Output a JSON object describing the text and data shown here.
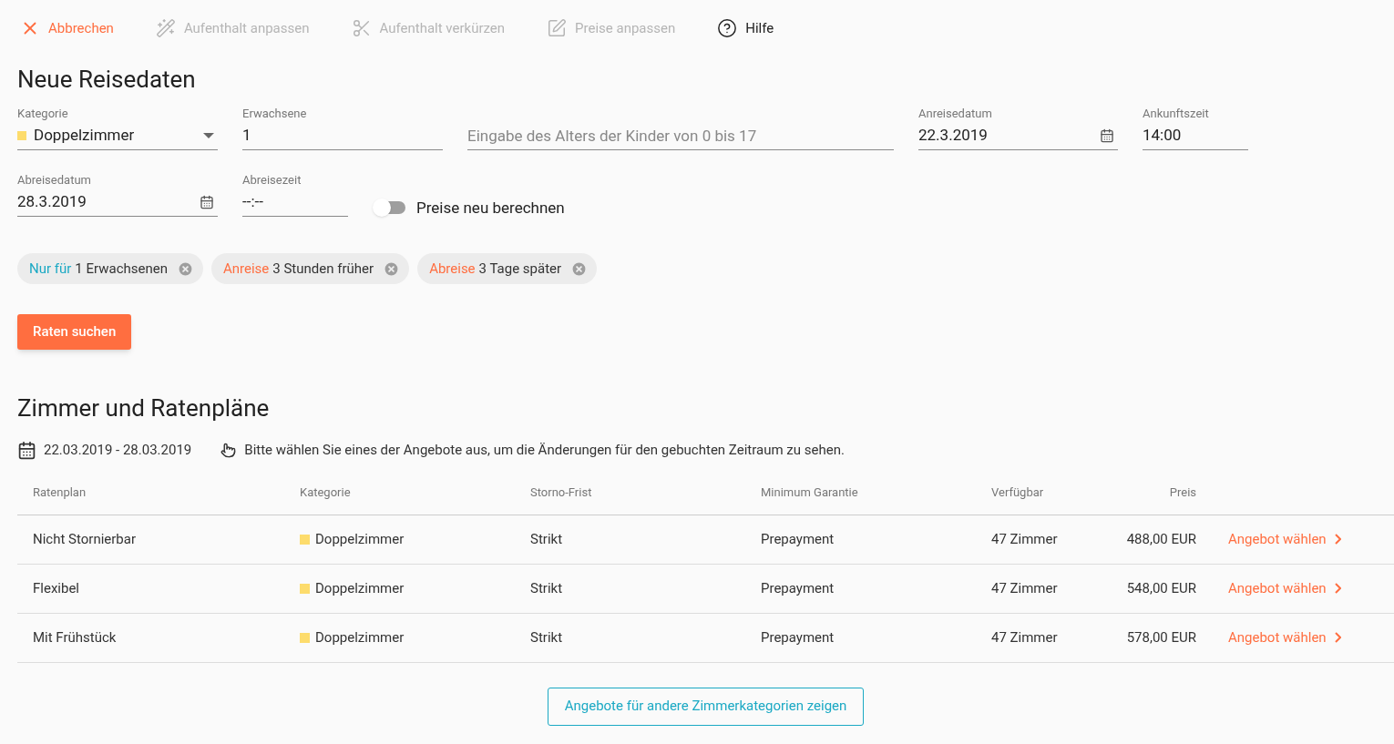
{
  "toolbar": [
    {
      "kind": "cancel",
      "label": "Abbrechen",
      "disabled": false
    },
    {
      "kind": "wand",
      "label": "Aufenthalt anpassen",
      "disabled": true
    },
    {
      "kind": "scissors",
      "label": "Aufenthalt verkürzen",
      "disabled": true
    },
    {
      "kind": "edit",
      "label": "Preise anpassen",
      "disabled": true
    },
    {
      "kind": "help",
      "label": "Hilfe",
      "disabled": false
    }
  ],
  "form": {
    "title": "Neue Reisedaten",
    "row_1": [
      {
        "kind": "select",
        "label": "Kategorie",
        "value": "Doppelzimmer",
        "color": "#fddc6c"
      },
      {
        "kind": "text",
        "label": "Erwachsene",
        "value": "1"
      },
      {
        "kind": "placeholder",
        "placeholder": "Eingabe des Alters der Kinder von 0 bis 17"
      },
      {
        "kind": "date",
        "label": "Anreisedatum",
        "value": "22.3.2019"
      },
      {
        "kind": "text",
        "label": "Ankunftszeit",
        "value": "14:00"
      }
    ],
    "row_2": [
      {
        "kind": "date",
        "label": "Abreisedatum",
        "value": "28.3.2019"
      },
      {
        "kind": "text",
        "label": "Abreisezeit",
        "value": "--:--"
      }
    ],
    "toggle": {
      "label": "Preise neu berechnen",
      "on": false
    },
    "chips": [
      {
        "prefix": "Nur für",
        "text": "1 Erwachsenen",
        "color": "#1ba9c4"
      },
      {
        "prefix": "Anreise",
        "text": "3 Stunden früher",
        "color": "#ff6e40"
      },
      {
        "prefix": "Abreise",
        "text": "3 Tage später",
        "color": "#ff6e40"
      }
    ],
    "search_button": "Raten suchen"
  },
  "rates": {
    "title": "Zimmer und Ratenpläne",
    "date_range": "22.03.2019 - 28.03.2019",
    "hint": "Bitte wählen Sie eines der Angebote aus, um die Änderungen für den gebuchten Zeitraum zu sehen.",
    "columns": [
      "Ratenplan",
      "Kategorie",
      "Storno-Frist",
      "Minimum Garantie",
      "Verfügbar",
      "Preis"
    ],
    "rows": [
      {
        "plan": "Nicht Stornierbar",
        "category": "Doppelzimmer",
        "color": "#fddc6c",
        "cancellation": "Strikt",
        "guarantee": "Prepayment",
        "available": "47 Zimmer",
        "price": "488,00 EUR",
        "action": "Angebot wählen"
      },
      {
        "plan": "Flexibel",
        "category": "Doppelzimmer",
        "color": "#fddc6c",
        "cancellation": "Strikt",
        "guarantee": "Prepayment",
        "available": "47 Zimmer",
        "price": "548,00 EUR",
        "action": "Angebot wählen"
      },
      {
        "plan": "Mit Frühstück",
        "category": "Doppelzimmer",
        "color": "#fddc6c",
        "cancellation": "Strikt",
        "guarantee": "Prepayment",
        "available": "47 Zimmer",
        "price": "578,00 EUR",
        "action": "Angebot wählen"
      }
    ],
    "more_button": "Angebote für andere Zimmerkategorien zeigen"
  }
}
